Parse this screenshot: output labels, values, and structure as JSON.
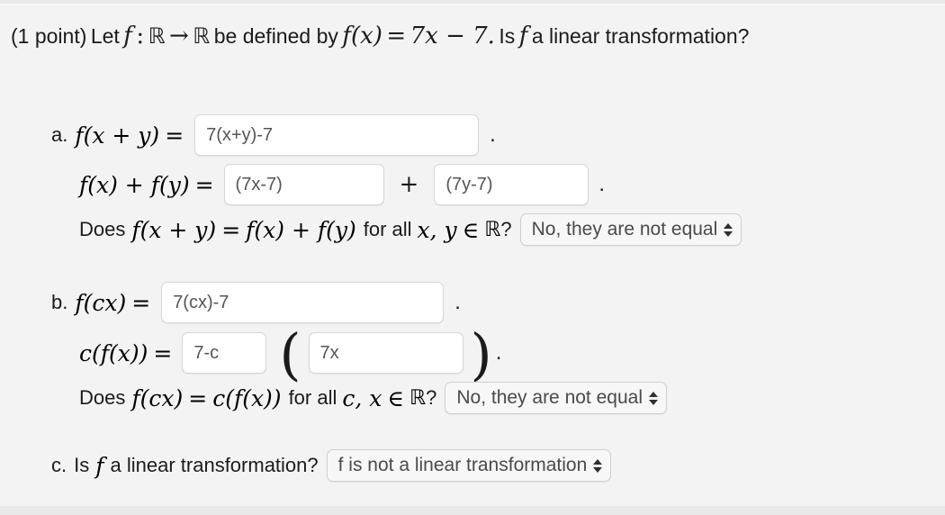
{
  "problem": {
    "points_label": "(1 point)",
    "stem_prefix": "Let",
    "fn_symbol": "f",
    "colon": ":",
    "domain_set": "ℝ",
    "arrow": "→",
    "codomain_set": "ℝ",
    "stem_mid": "be defined by",
    "definition_lhs": "f(x)",
    "definition_eq": "=",
    "definition_rhs": "7x − 7.",
    "stem_question_prefix": "Is",
    "stem_question_suffix": "a linear transformation?"
  },
  "part_a": {
    "marker": "a.",
    "line1_lhs": "f(x + y)",
    "line1_eq": "=",
    "answer1": "7(x+y)-7",
    "answer1_placeholder": "",
    "line1_period": ".",
    "line2_lhs": "f(x) + f(y)",
    "line2_eq": "=",
    "answer2": "(7x-7)",
    "answer2_placeholder": "",
    "plus": "+",
    "answer3": "(7y-7)",
    "answer3_placeholder": "",
    "line2_period": ".",
    "question_does": "Does",
    "question_lhs": "f(x + y)",
    "question_eq": "=",
    "question_rhs": "f(x) + f(y)",
    "question_forall": "for all",
    "question_vars": "x, y",
    "question_in": "∈",
    "question_set": "ℝ",
    "question_mark": "?",
    "dropdown_value": "No, they are not equal"
  },
  "part_b": {
    "marker": "b.",
    "line1_lhs": "f(cx)",
    "line1_eq": "=",
    "answer1": "7(cx)-7",
    "answer1_placeholder": "",
    "line1_period": ".",
    "line2_lhs": "c(f(x))",
    "line2_eq": "=",
    "answer2": "7-c",
    "answer2_placeholder": "",
    "paren_open": "(",
    "answer3": "7x",
    "answer3_placeholder": "",
    "paren_close": ")",
    "line2_period": ".",
    "question_does": "Does",
    "question_lhs": "f(cx)",
    "question_eq": "=",
    "question_rhs": "c(f(x))",
    "question_forall": "for all",
    "question_vars": "c, x",
    "question_in": "∈",
    "question_set": "ℝ",
    "question_mark": "?",
    "dropdown_value": "No, they are not equal"
  },
  "part_c": {
    "marker": "c.",
    "question_prefix": "Is",
    "fn_symbol": "f",
    "question_suffix": "a linear transformation?",
    "dropdown_value": "f is not a linear transformation"
  },
  "colors": {
    "page_background": "#f3f3f3",
    "text": "#1b1b1b",
    "input_text": "#555555",
    "input_border": "#d6d6d6",
    "select_background": "#f7f7f7"
  }
}
